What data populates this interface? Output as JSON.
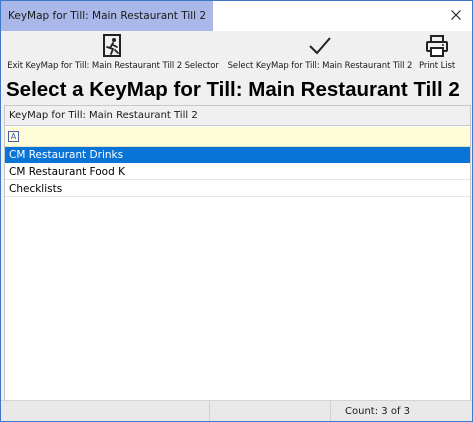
{
  "window": {
    "title": "KeyMap for Till: Main Restaurant Till 2"
  },
  "toolbar": {
    "buttons": [
      {
        "label": "Exit KeyMap for Till: Main Restaurant Till 2 Selector",
        "icon": "exit-door-runner-icon"
      },
      {
        "label": "Select KeyMap for Till: Main Restaurant Till 2",
        "icon": "checkmark-icon"
      },
      {
        "label": "Print List",
        "icon": "printer-icon"
      }
    ]
  },
  "heading": "Select a KeyMap for Till: Main Restaurant Till 2",
  "grid": {
    "column_header": "KeyMap for Till: Main Restaurant Till 2",
    "filter_icon": "A",
    "rows": [
      {
        "label": "CM Restaurant Drinks",
        "selected": true
      },
      {
        "label": "CM Restaurant Food K",
        "selected": false
      },
      {
        "label": "Checklists",
        "selected": false
      }
    ]
  },
  "status": {
    "count": "Count: 3 of 3"
  },
  "colors": {
    "title_tab": "#a9b8e8",
    "selection": "#0a74d6",
    "filter_row": "#fdfbd8",
    "window_border": "#3e78c8"
  }
}
